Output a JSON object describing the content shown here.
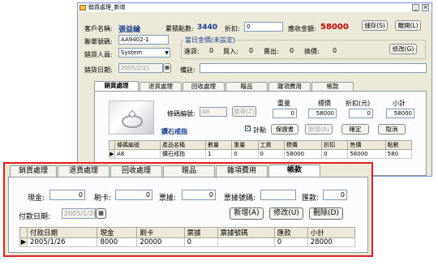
{
  "window": {
    "title": "銷貨處理_新增",
    "min": "_",
    "close": "×"
  },
  "header": {
    "customer_label": "客戶名稱:",
    "customer_value": "張益綸",
    "points_label": "累積點數:",
    "points_value": "3440",
    "discount_label": "折扣:",
    "discount_value": "0",
    "total_label": "應收金額:",
    "total_value": "58000",
    "save_label": "儲存(S)",
    "leave_label": "離開(L)",
    "member_no_label": "聯單號碼:",
    "member_no_value": "AA9402-1",
    "salesperson_label": "銷貨人員:",
    "salesperson_value": "System",
    "date_label": "銷貨日期:",
    "date_value": "2005/2/21",
    "note_label": "備註:",
    "note_value": ""
  },
  "gold": {
    "title": "當日金價(未設定)",
    "sell_in_label": "進貨:",
    "sell_in_value": "0",
    "buy_in_label": "買入:",
    "buy_in_value": "0",
    "sell_out_label": "賣出:",
    "sell_out_value": "0",
    "exchange_label": "換價:",
    "exchange_value": "0",
    "modify_label": "修改(G)"
  },
  "tabs": [
    "銷貨處理",
    "退貨處理",
    "回收處理",
    "贈品",
    "雜項費用",
    "帳款"
  ],
  "sales_panel": {
    "barcode_label": "條碼編號:",
    "barcode_value": "A8",
    "search_label": "搜尋(Z)",
    "product_name": "鑽石戒指",
    "weight_label": "重量",
    "weight_value": "0",
    "price_label": "標價",
    "price_value": "58000",
    "discount_label": "折扣(元)",
    "discount_value": "0",
    "subtotal_label": "小計",
    "subtotal_value": "58000",
    "count_label": "計點",
    "count_checked": "✓",
    "warranty_label": "保證書",
    "add_label": "新增(A)",
    "confirm_label": "確定",
    "cancel_label": "取消",
    "columns": [
      "條碼編號",
      "產品名稱",
      "數量",
      "重量",
      "工資",
      "標價",
      "折扣",
      "售價",
      "點數"
    ],
    "rows": [
      [
        "A8",
        "鑽石戒指",
        "1",
        "0",
        "0",
        "58000",
        "0",
        "58000",
        "580"
      ]
    ],
    "row_marker": "▶"
  },
  "zoom": {
    "tabs": [
      "銷貨處理",
      "退貨處理",
      "回收處理",
      "贈品",
      "雜項費用",
      "帳款"
    ],
    "cash_label": "現金:",
    "cash_value": "0",
    "card_label": "刷卡:",
    "card_value": "0",
    "check_label": "票據:",
    "check_value": "0",
    "check_no_label": "票據號碼:",
    "check_no_value": "",
    "remit_label": "匯款:",
    "remit_value": "0",
    "pay_date_label": "付款日期:",
    "pay_date_value": "2005/1/26",
    "add_label": "新增(A)",
    "edit_label": "修改(U)",
    "delete_label": "刪除(D)",
    "columns": [
      "付款日期",
      "現金",
      "刷卡",
      "票據",
      "票據號碼",
      "匯款",
      "小計"
    ],
    "rows": [
      [
        "2005/1/26",
        "8000",
        "20000",
        "0",
        "",
        "0",
        "28000"
      ]
    ],
    "row_marker": "▶"
  }
}
